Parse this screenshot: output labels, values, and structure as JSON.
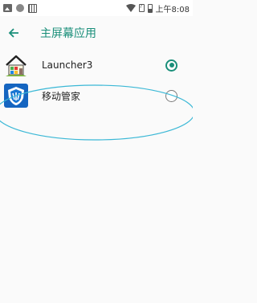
{
  "status_bar": {
    "time": "上午8:08",
    "icons": [
      "image-icon",
      "dot-icon",
      "news-icon",
      "wifi-icon",
      "sim-icon",
      "battery-icon"
    ]
  },
  "app_bar": {
    "title": "主屏幕应用",
    "back_icon": "arrow-back-icon"
  },
  "apps": [
    {
      "name": "Launcher3",
      "selected": true,
      "icon": "launcher-house-icon"
    },
    {
      "name": "移动管家",
      "selected": false,
      "icon": "shield-manager-icon"
    }
  ],
  "colors": {
    "accent": "#1a8f7a",
    "annotation": "#3bb8d6",
    "background": "#fafafa"
  }
}
